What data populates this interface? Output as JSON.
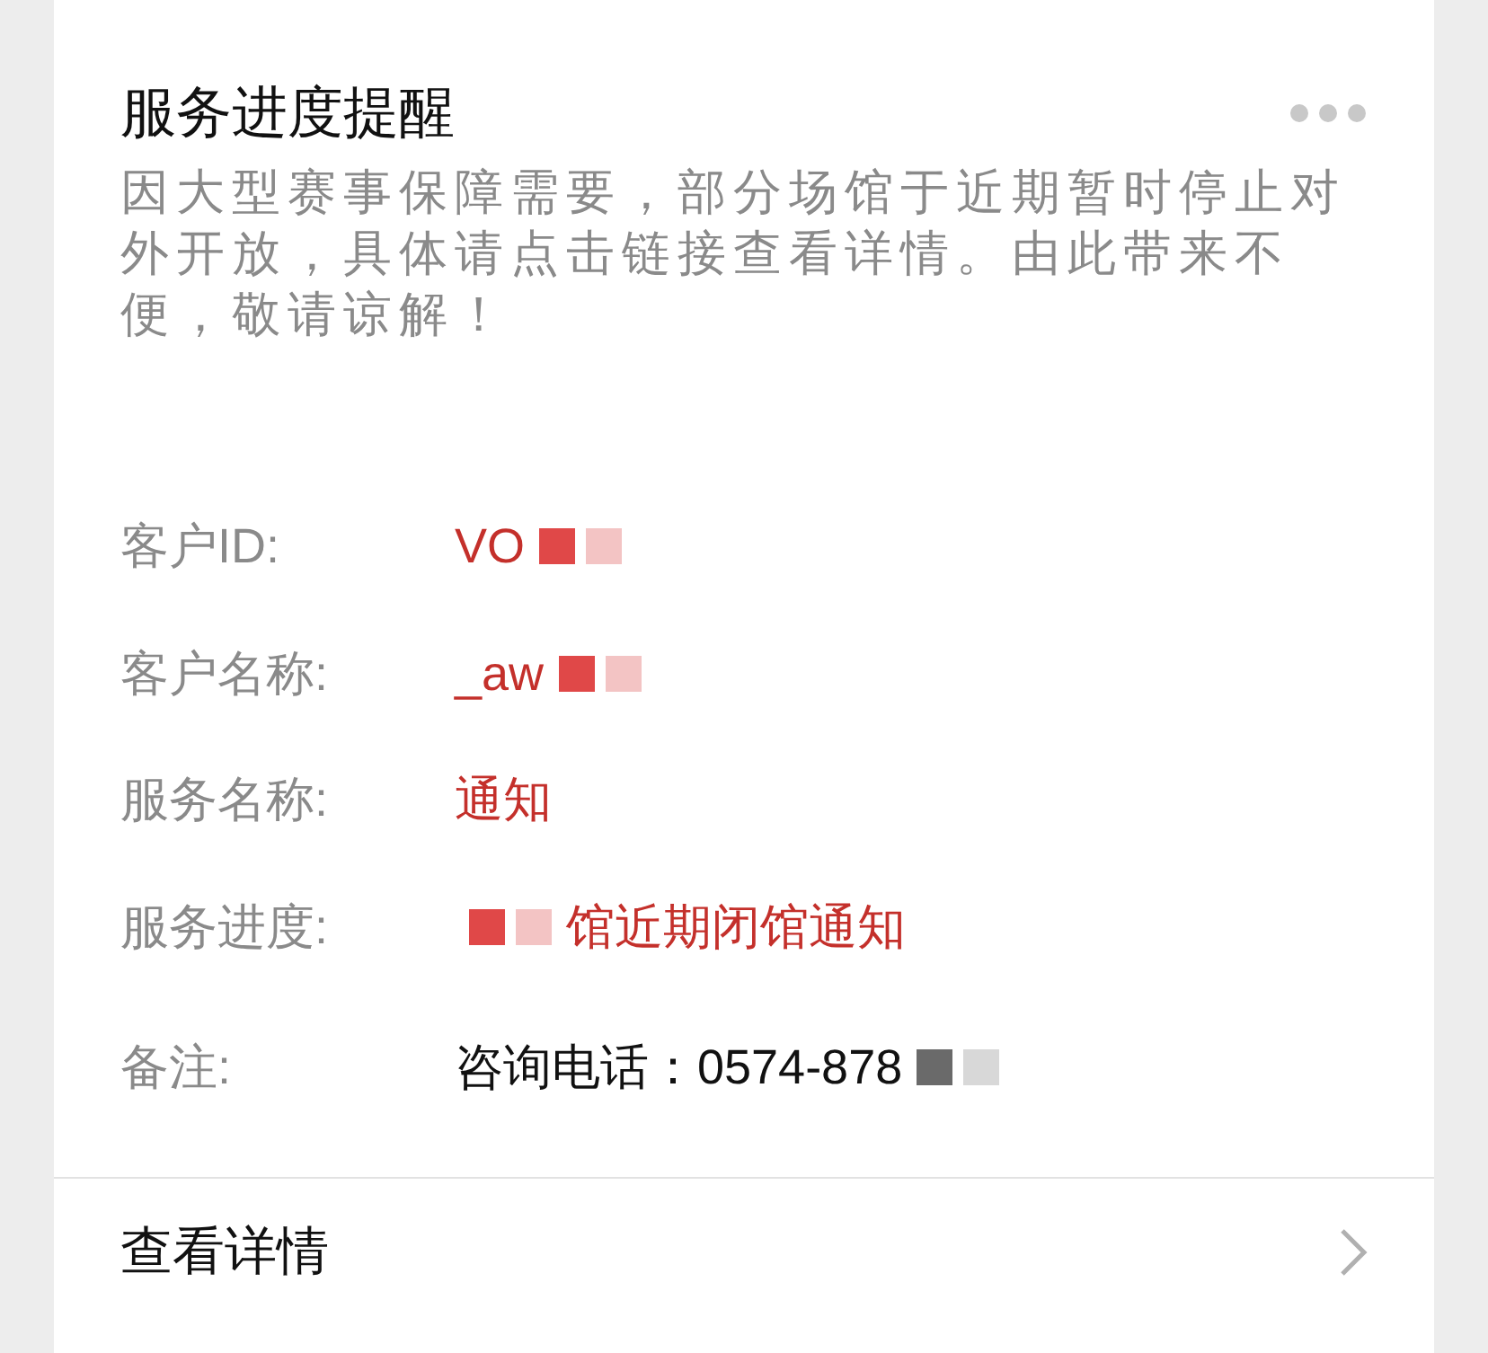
{
  "card": {
    "title": "服务进度提醒",
    "description": "因大型赛事保障需要，部分场馆于近期暂时停止对外开放，具体请点击链接查看详情。由此带来不便，敬请谅解！",
    "fields": [
      {
        "label": "客户ID:",
        "value": "VO",
        "kind": "highlight",
        "mosaic_before": false,
        "mosaic_after": true
      },
      {
        "label": "客户名称:",
        "value": "_aw",
        "kind": "highlight",
        "mosaic_before": false,
        "mosaic_after": true
      },
      {
        "label": "服务名称:",
        "value": "通知",
        "kind": "highlight",
        "mosaic_before": false,
        "mosaic_after": false
      },
      {
        "label": "服务进度:",
        "value": "馆近期闭馆通知",
        "kind": "highlight",
        "mosaic_before": true,
        "mosaic_after": false
      }
    ],
    "remark": {
      "label": "备注:",
      "value": "咨询电话：0574-878",
      "kind": "plain",
      "mosaic_before": false,
      "mosaic_after": true
    },
    "footer": {
      "link": "查看详情"
    }
  }
}
